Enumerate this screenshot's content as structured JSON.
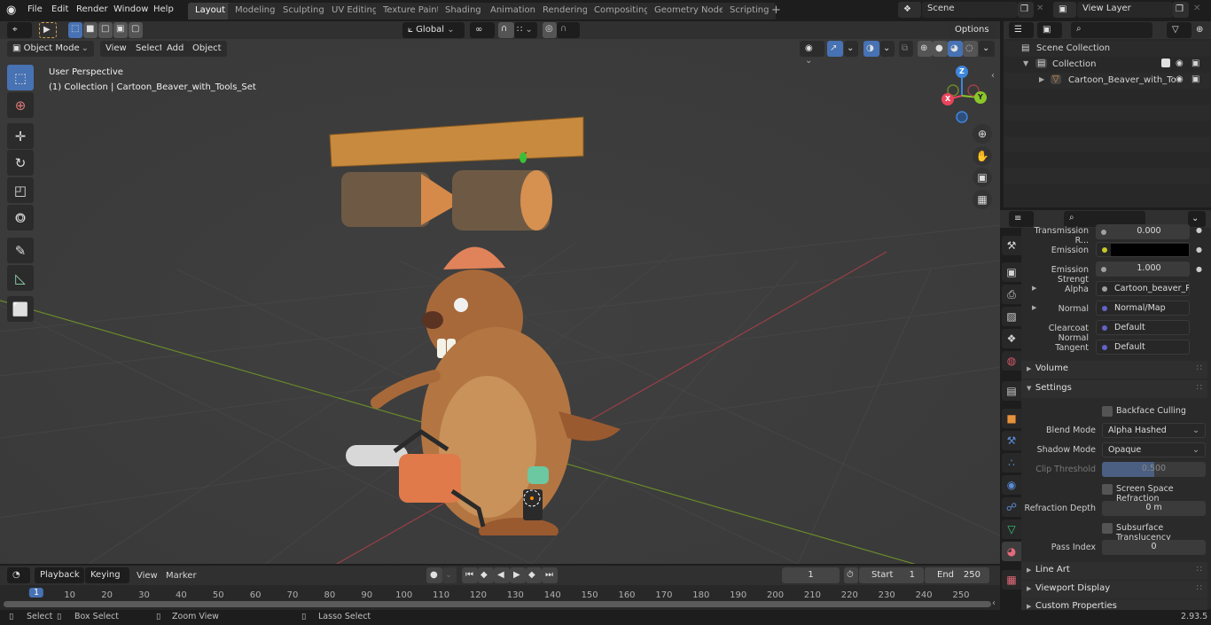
{
  "topbar": {
    "menus": [
      "File",
      "Edit",
      "Render",
      "Window",
      "Help"
    ],
    "workspaces": [
      "Layout",
      "Modeling",
      "Sculpting",
      "UV Editing",
      "Texture Paint",
      "Shading",
      "Animation",
      "Rendering",
      "Compositing",
      "Geometry Nodes",
      "Scripting"
    ],
    "active_workspace": "Layout",
    "add_workspace": "+",
    "scene": "Scene",
    "view_layer": "View Layer"
  },
  "viewport_header": {
    "mode": "Object Mode",
    "menus": [
      "View",
      "Select",
      "Add",
      "Object"
    ],
    "transform_orientation": "Global",
    "options": "Options"
  },
  "viewport": {
    "view_name": "User Perspective",
    "collection_info": "(1) Collection | Cartoon_Beaver_with_Tools_Set",
    "gizmo_axes": {
      "x": "X",
      "y": "Y",
      "z": "Z"
    },
    "colors": {
      "x_axis": "#e8455d",
      "y_axis": "#8ac72a",
      "z_axis": "#3d86dd",
      "grid_x_line": "#9a3f47",
      "grid_y_line": "#6a8a2a"
    },
    "tools": [
      "select-box",
      "cursor",
      "move",
      "rotate",
      "scale",
      "transform",
      "annotate",
      "measure",
      "add-cube"
    ]
  },
  "outliner": {
    "root": "Scene Collection",
    "items": [
      {
        "label": "Collection",
        "level": 1,
        "expanded": true,
        "checked": true
      },
      {
        "label": "Cartoon_Beaver_with_To",
        "level": 2,
        "expanded": false
      }
    ]
  },
  "properties": {
    "rows": [
      {
        "label": "Transmission R...",
        "value": "0.000",
        "type": "slider",
        "socket": "#a0a0a0"
      },
      {
        "label": "Emission",
        "value": "",
        "type": "color",
        "socket": "#c7c729",
        "color": "#000000"
      },
      {
        "label": "Emission Strengt",
        "value": "1.000",
        "type": "slider",
        "socket": "#a0a0a0"
      },
      {
        "label": "Alpha",
        "value": "Cartoon_beaver_Re...",
        "type": "link",
        "socket": "#a0a0a0",
        "expandable": true
      },
      {
        "label": "Normal",
        "value": "Normal/Map",
        "type": "link",
        "socket": "#6363c7",
        "expandable": true
      },
      {
        "label": "Clearcoat Normal",
        "value": "Default",
        "type": "link",
        "socket": "#6363c7"
      },
      {
        "label": "Tangent",
        "value": "Default",
        "type": "link",
        "socket": "#6363c7"
      }
    ],
    "panels": {
      "volume": "Volume",
      "settings": "Settings",
      "line_art": "Line Art",
      "viewport_display": "Viewport Display",
      "custom_properties": "Custom Properties"
    },
    "settings": {
      "backface_culling": "Backface Culling",
      "blend_mode_label": "Blend Mode",
      "blend_mode": "Alpha Hashed",
      "shadow_mode_label": "Shadow Mode",
      "shadow_mode": "Opaque",
      "clip_threshold_label": "Clip Threshold",
      "clip_threshold": "0.500",
      "clip_threshold_fraction": 0.5,
      "screen_space_refraction": "Screen Space Refraction",
      "refraction_depth_label": "Refraction Depth",
      "refraction_depth": "0 m",
      "subsurface_translucency": "Subsurface Translucency",
      "pass_index_label": "Pass Index",
      "pass_index": "0"
    }
  },
  "timeline": {
    "menus": [
      "Playback",
      "Keying",
      "View",
      "Marker"
    ],
    "current_frame": "1",
    "start_label": "Start",
    "start": "1",
    "end_label": "End",
    "end": "250",
    "ticks": [
      "1",
      "10",
      "20",
      "30",
      "40",
      "50",
      "60",
      "70",
      "80",
      "90",
      "100",
      "110",
      "120",
      "130",
      "140",
      "150",
      "160",
      "170",
      "180",
      "190",
      "200",
      "210",
      "220",
      "230",
      "240",
      "250"
    ]
  },
  "statusbar": {
    "select": "Select",
    "box_select": "Box Select",
    "zoom_view": "Zoom View",
    "lasso_select": "Lasso Select",
    "version": "2.93.5"
  }
}
